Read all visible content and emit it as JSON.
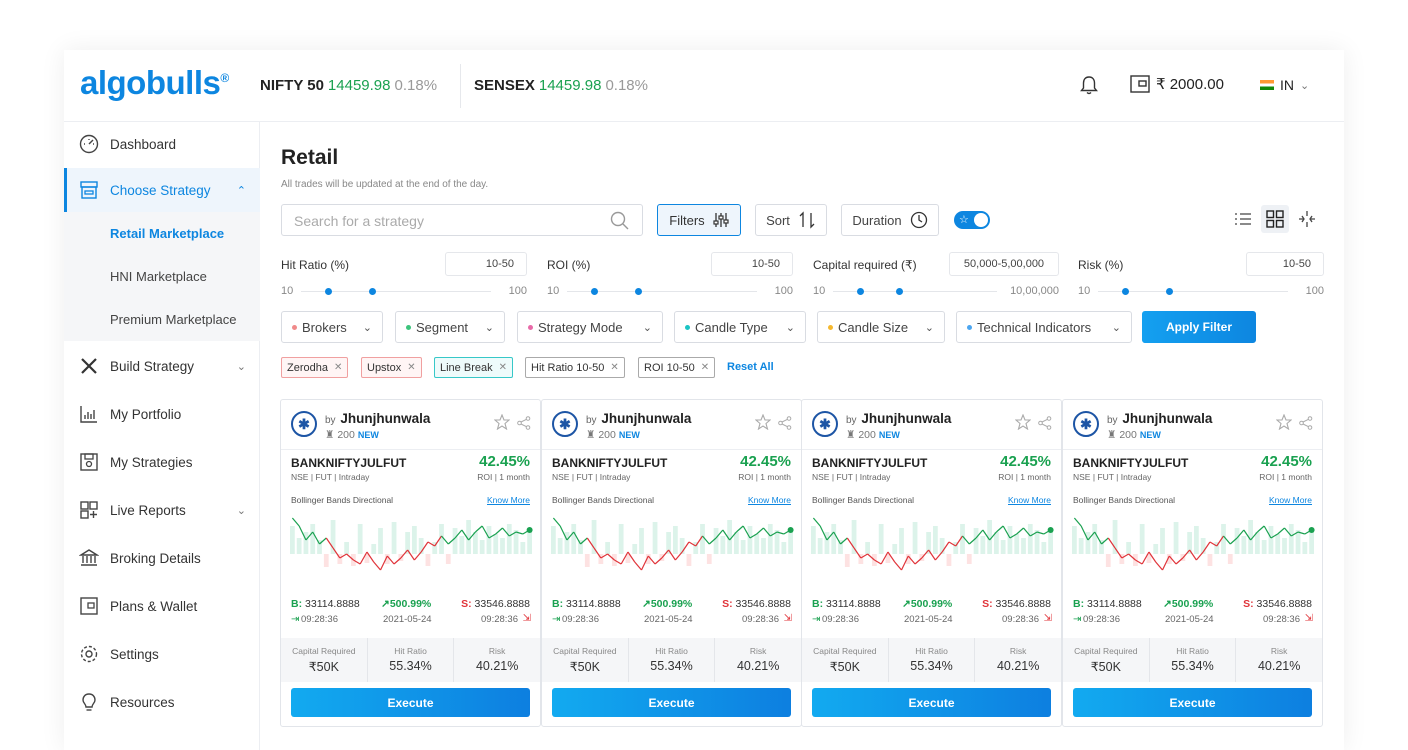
{
  "header": {
    "logo": "algobulls",
    "logo_mark": "®",
    "tickers": [
      {
        "name": "NIFTY 50",
        "value": "14459.98",
        "change": "0.18%"
      },
      {
        "name": "SENSEX",
        "value": "14459.98",
        "change": "0.18%"
      }
    ],
    "wallet_balance": "₹ 2000.00",
    "country": "IN"
  },
  "sidebar": {
    "items": [
      {
        "label": "Dashboard",
        "icon": "dashboard-gauge-icon"
      },
      {
        "label": "Choose Strategy",
        "icon": "store-icon",
        "expanded": true,
        "active": true
      },
      {
        "label": "Build Strategy",
        "icon": "tools-icon",
        "expanded": false
      },
      {
        "label": "My Portfolio",
        "icon": "bar-chart-icon"
      },
      {
        "label": "My Strategies",
        "icon": "save-icon"
      },
      {
        "label": "Live Reports",
        "icon": "grid-plus-icon",
        "expanded": false
      },
      {
        "label": "Broking Details",
        "icon": "bank-icon"
      },
      {
        "label": "Plans & Wallet",
        "icon": "wallet-icon"
      },
      {
        "label": "Settings",
        "icon": "gear-icon"
      },
      {
        "label": "Resources",
        "icon": "bulb-icon"
      }
    ],
    "sub_items": [
      "Retail Marketplace",
      "HNI Marketplace",
      "Premium Marketplace"
    ]
  },
  "page": {
    "title": "Retail",
    "subtitle": "All trades will be updated at the end of the day.",
    "search_placeholder": "Search for a strategy",
    "filters_label": "Filters",
    "sort_label": "Sort",
    "duration_label": "Duration",
    "favorites_toggle": true
  },
  "ranges": [
    {
      "label": "Hit Ratio (%)",
      "value": "10-50",
      "min": "10",
      "max": "100"
    },
    {
      "label": "ROI (%)",
      "value": "10-50",
      "min": "10",
      "max": "100"
    },
    {
      "label": "Capital required (₹)",
      "value": "50,000-5,00,000",
      "min": "10",
      "max": "10,00,000"
    },
    {
      "label": "Risk (%)",
      "value": "10-50",
      "min": "10",
      "max": "100"
    }
  ],
  "dropdowns": [
    {
      "label": "Brokers",
      "color": "#f08a8a"
    },
    {
      "label": "Segment",
      "color": "#3cc47c"
    },
    {
      "label": "Strategy Mode",
      "color": "#e86aa8"
    },
    {
      "label": "Candle Type",
      "color": "#1bc4c4"
    },
    {
      "label": "Candle Size",
      "color": "#f5b82e"
    },
    {
      "label": "Technical Indicators",
      "color": "#4ca6f0"
    }
  ],
  "apply_filter_label": "Apply Filter",
  "chips": [
    {
      "label": "Zerodha",
      "border": "#f0a0a0",
      "bg": "#fff5f5"
    },
    {
      "label": "Upstox",
      "border": "#f0a0a0",
      "bg": "#fff5f5"
    },
    {
      "label": "Line Break",
      "border": "#37c8c8",
      "bg": "#eefbfb"
    },
    {
      "label": "Hit Ratio 10-50",
      "border": "#aaaaaa",
      "bg": "#ffffff"
    },
    {
      "label": "ROI 10-50",
      "border": "#aaaaaa",
      "bg": "#ffffff"
    }
  ],
  "reset_all_label": "Reset All",
  "card": {
    "by": "by",
    "author": "Jhunjhunwala",
    "followers": "200",
    "new_badge": "NEW",
    "instrument": "BANKNIFTYJULFUT",
    "meta": "NSE | FUT | Intraday",
    "roi": "42.45%",
    "roi_meta": "ROI | 1 month",
    "strategy": "Bollinger Bands Directional",
    "know_more": "Know More",
    "buy_label": "B:",
    "buy_price": "33114.8888",
    "buy_time": "09:28:36",
    "gain": "500.99%",
    "date": "2021-05-24",
    "sell_label": "S:",
    "sell_price": "33546.8888",
    "sell_time": "09:28:36",
    "stats": [
      {
        "label": "Capital Required",
        "value": "₹50K"
      },
      {
        "label": "Hit Ratio",
        "value": "55.34%"
      },
      {
        "label": "Risk",
        "value": "40.21%"
      }
    ],
    "execute_label": "Execute"
  },
  "colors": {
    "accent": "#0d86e0",
    "positive": "#1aa150",
    "negative": "#e0343a"
  }
}
